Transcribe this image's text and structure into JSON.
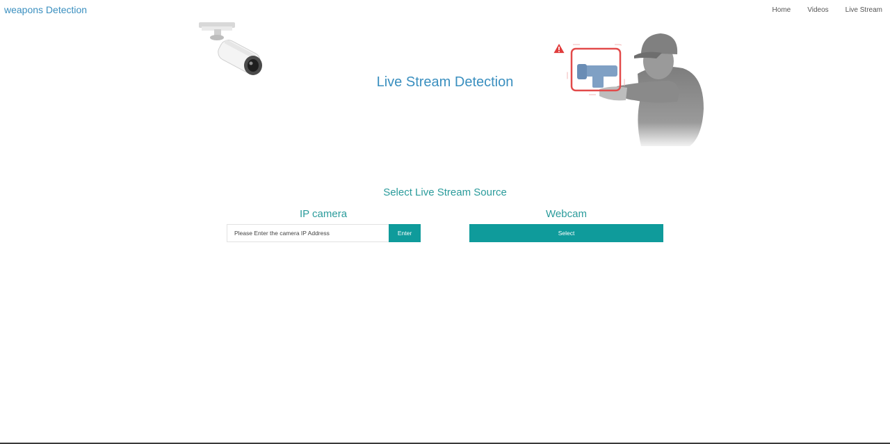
{
  "navbar": {
    "brand": "weapons Detection",
    "links": [
      {
        "label": "Home"
      },
      {
        "label": "Videos"
      },
      {
        "label": "Live Stream"
      }
    ]
  },
  "hero": {
    "title": "Live Stream Detection",
    "left_image_icon": "security-camera-icon",
    "right_image_icon": "armed-person-detection-icon",
    "alert_icon": "warning-triangle-icon"
  },
  "source": {
    "title": "Select Live Stream Source",
    "ip_camera": {
      "heading": "IP camera",
      "placeholder": "Please Enter the camera IP Address",
      "value": "",
      "button_label": "Enter"
    },
    "webcam": {
      "heading": "Webcam",
      "button_label": "Select"
    }
  },
  "colors": {
    "brand": "#3a8fbf",
    "accent": "#0f9b9b",
    "heading_teal": "#2a9b9b",
    "alert_red": "#e03c3c"
  }
}
